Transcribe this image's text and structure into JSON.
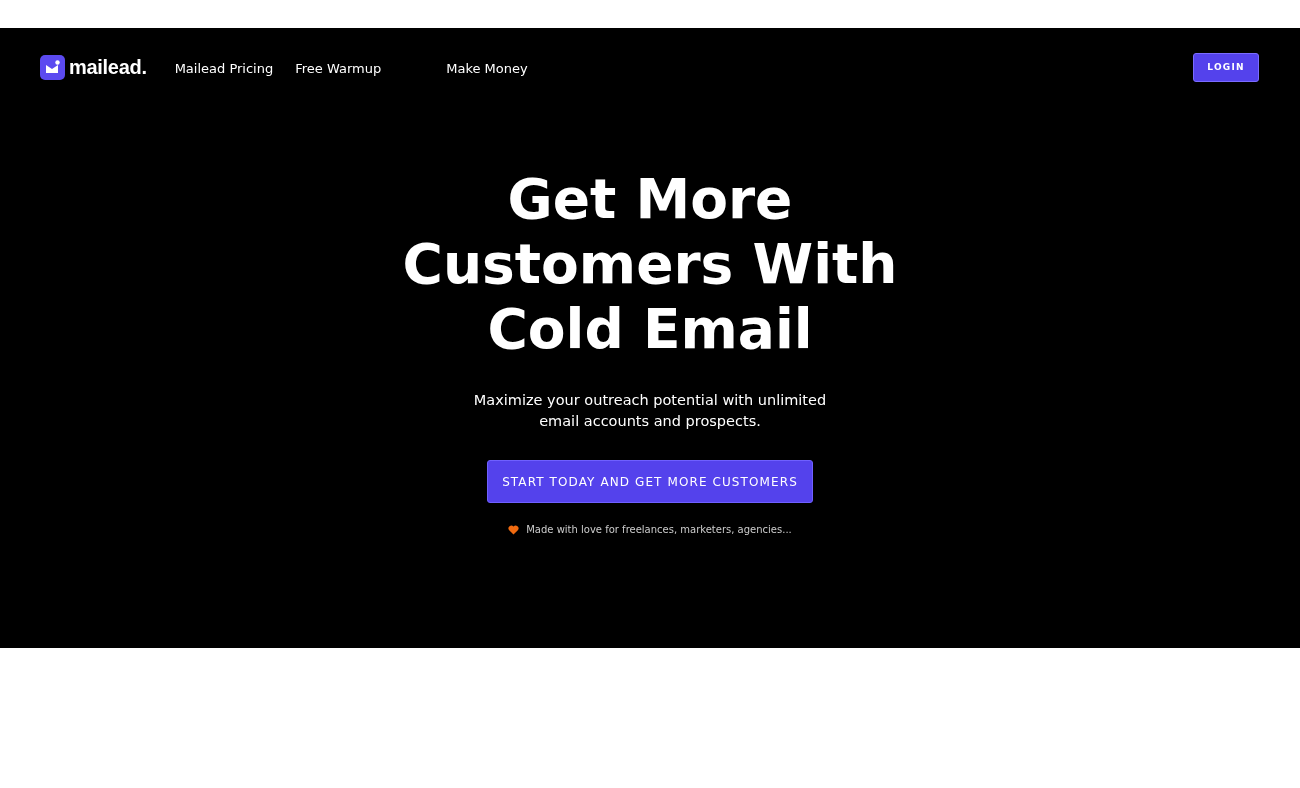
{
  "logo": {
    "text": "mailead."
  },
  "nav": [
    {
      "label": "Mailead Pricing"
    },
    {
      "label": "Free Warmup"
    },
    {
      "label": "Make Money"
    }
  ],
  "login_button": "LOGIN",
  "hero": {
    "title_lines": [
      "Get More",
      "Customers With",
      "Cold Email"
    ],
    "subtitle": "Maximize your outreach potential with unlimited email accounts and prospects.",
    "cta": "START TODAY AND GET MORE CUSTOMERS",
    "note": "Made with love for freelances, marketers, agencies..."
  }
}
